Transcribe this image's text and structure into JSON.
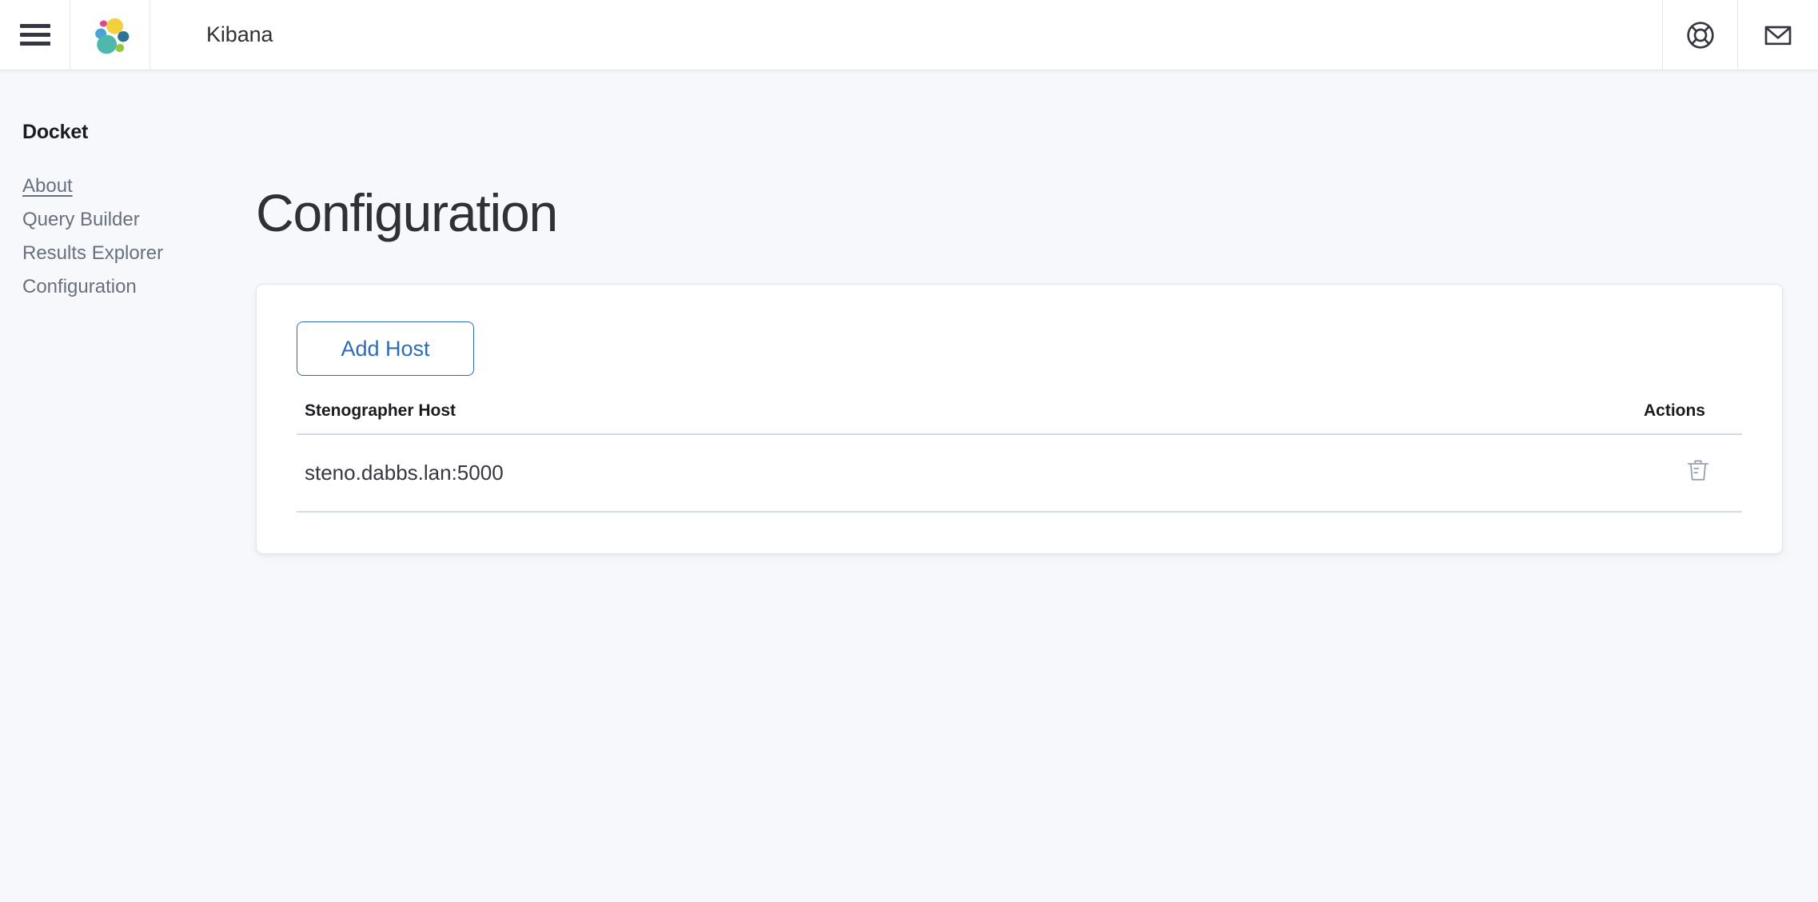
{
  "header": {
    "title": "Kibana",
    "menu_icon": "hamburger-menu-icon",
    "logo_icon": "elastic-logo-icon",
    "help_icon": "help-life-ring-icon",
    "mail_icon": "envelope-icon"
  },
  "sidebar": {
    "title": "Docket",
    "items": [
      {
        "label": "About",
        "active": true
      },
      {
        "label": "Query Builder",
        "active": false
      },
      {
        "label": "Results Explorer",
        "active": false
      },
      {
        "label": "Configuration",
        "active": false
      }
    ]
  },
  "main": {
    "page_title": "Configuration",
    "add_host_button": "Add Host",
    "table": {
      "columns": [
        "Stenographer Host",
        "Actions"
      ],
      "rows": [
        {
          "host": "steno.dabbs.lan:5000",
          "action_icon": "trash-icon"
        }
      ]
    }
  },
  "colors": {
    "background": "#F7F8FC",
    "panel": "#FFFFFF",
    "accent_blue": "#2C6CB4",
    "text_primary": "#343741",
    "text_muted": "#69707D",
    "border": "#D3DAE6"
  }
}
